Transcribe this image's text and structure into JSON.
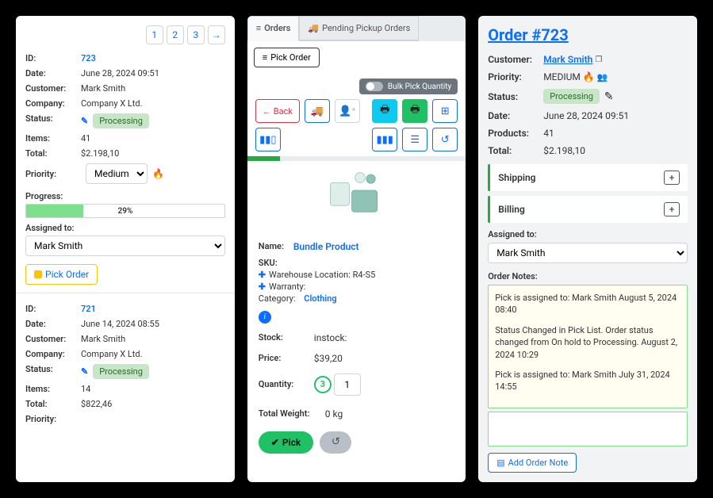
{
  "left": {
    "pager": [
      "1",
      "2",
      "3"
    ],
    "order1": {
      "id_label": "ID:",
      "id": "723",
      "date_label": "Date:",
      "date": "June 28, 2024 09:51",
      "customer_label": "Customer:",
      "customer": "Mark Smith",
      "company_label": "Company:",
      "company": "Company X Ltd.",
      "status_label": "Status:",
      "status": "Processing",
      "items_label": "Items:",
      "items": "41",
      "total_label": "Total:",
      "total": "$2.198,10",
      "priority_label": "Priority:",
      "priority": "Medium",
      "progress_label": "Progress:",
      "progress_txt": "29%",
      "progress_pct": 29,
      "assigned_label": "Assigned to:",
      "assigned": "Mark Smith",
      "pick_btn": "Pick Order"
    },
    "order2": {
      "id_label": "ID:",
      "id": "721",
      "date_label": "Date:",
      "date": "June 14, 2024 08:55",
      "customer_label": "Customer:",
      "customer": "Mark Smith",
      "company_label": "Company:",
      "company": "Company X Ltd.",
      "status_label": "Status:",
      "status": "Processing",
      "items_label": "Items:",
      "items": "14",
      "total_label": "Total:",
      "total": "$822,46",
      "priority_label": "Priority:"
    }
  },
  "mid": {
    "tab_orders": "Orders",
    "tab_pending": "Pending Pickup Orders",
    "pick_order_btn": "Pick Order",
    "bulk_toggle": "Bulk Pick Quantity",
    "back": "Back",
    "product": {
      "name_label": "Name:",
      "name": "Bundle Product",
      "sku_label": "SKU:",
      "warehouse_label": "Warehouse Location: R4-S5",
      "warranty_label": "Warranty:",
      "category_label": "Category:",
      "category": "Clothing",
      "stock_label": "Stock:",
      "stock": "instock:",
      "price_label": "Price:",
      "price": "$39,20",
      "qty_label": "Quantity:",
      "qty_badge": "3",
      "qty_value": "1",
      "weight_label": "Total Weight:",
      "weight": "0 kg",
      "pick_btn": "Pick"
    }
  },
  "right": {
    "title": "Order #723",
    "customer_label": "Customer:",
    "customer": "Mark Smith",
    "priority_label": "Priority:",
    "priority": "MEDIUM",
    "status_label": "Status:",
    "status": "Processing",
    "date_label": "Date:",
    "date": "June 28, 2024 09:51",
    "products_label": "Products:",
    "products": "41",
    "total_label": "Total:",
    "total": "$2.198,10",
    "shipping": "Shipping",
    "billing": "Billing",
    "assigned_label": "Assigned to:",
    "assigned": "Mark Smith",
    "notes_label": "Order Notes:",
    "note1": "Pick is assigned to: Mark Smith August 5, 2024 08:40",
    "note2": "Status Changed in Pick List. Order status changed from On hold to Processing. August 2, 2024 10:29",
    "note3": "Pick is assigned to: Mark Smith July 31, 2024 14:55",
    "add_note_btn": "Add Order Note"
  }
}
